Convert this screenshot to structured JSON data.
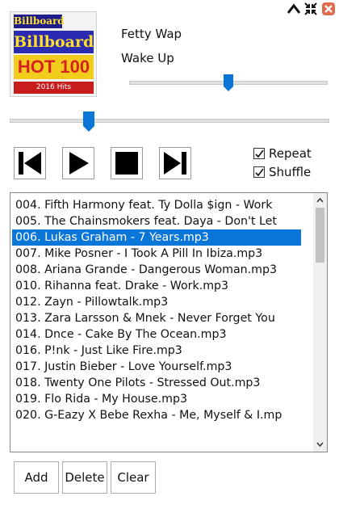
{
  "window": {
    "controls": {
      "up_icon": "chevron-up-icon",
      "shrink_icon": "shrink-arrows-icon",
      "close_icon": "close-icon",
      "close_color": "#e06b4f"
    }
  },
  "album_art": {
    "line1": "Billboard",
    "line2": "Billboard",
    "line3": "HOT 100",
    "line4": "2016 Hits"
  },
  "now_playing": {
    "artist": "Fetty Wap",
    "title": "Wake Up"
  },
  "volume": {
    "level": 0.49
  },
  "seek": {
    "position": 0.25
  },
  "transport": {
    "prev_icon": "skip-previous-icon",
    "play_icon": "play-icon",
    "stop_icon": "stop-icon",
    "next_icon": "skip-next-icon"
  },
  "options": {
    "repeat_label": "Repeat",
    "repeat_checked": true,
    "shuffle_label": "Shuffle",
    "shuffle_checked": true
  },
  "playlist": {
    "selected_index": 2,
    "selection_color": "#0a76d8",
    "items": [
      "004. Fifth Harmony feat. Ty Dolla $ign - Work",
      "005. The Chainsmokers feat. Daya - Don't Let",
      "006. Lukas Graham - 7 Years.mp3",
      "007. Mike Posner - I Took A Pill In Ibiza.mp3",
      "008. Ariana Grande - Dangerous Woman.mp3",
      "010. Rihanna feat. Drake - Work.mp3",
      "012. Zayn - Pillowtalk.mp3",
      "013. Zara Larsson & Mnek - Never Forget You",
      "014. Dnce - Cake By The Ocean.mp3",
      "016. P!nk - Just Like Fire.mp3",
      "017. Justin Bieber - Love Yourself.mp3",
      "018. Twenty One Pilots - Stressed Out.mp3",
      "019. Flo Rida - My House.mp3",
      "020. G-Eazy X Bebe Rexha - Me, Myself & I.mp"
    ]
  },
  "buttons": {
    "add": "Add",
    "delete": "Delete",
    "clear": "Clear"
  }
}
